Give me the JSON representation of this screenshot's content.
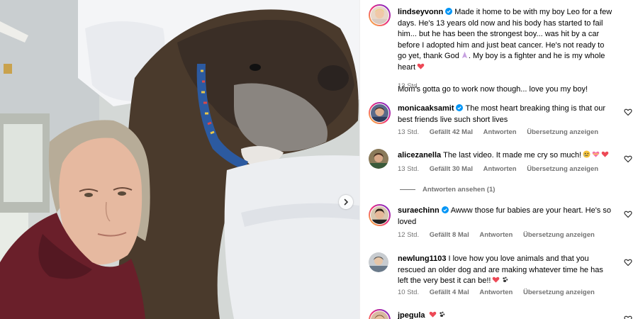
{
  "post": {
    "username": "lindseyvonn",
    "caption_p1": "Made it home to be with my boy Leo for a few days. He's 13 years old now and his body has started to fail him... but he has been the strongest boy... was hit by a car before I adopted him and just beat cancer. He's not ready to go yet, thank God",
    "caption_p2": ". My boy is a fighter and he is my whole heart",
    "caption_p3": "Mom's gotta go to work now though... love you my boy!",
    "time": "13 Std."
  },
  "comments": [
    {
      "username": "monicaaksamit",
      "verified": true,
      "text": "The most heart breaking thing is that our best friends live such short lives",
      "time": "13 Std.",
      "likes": "Gefällt 42 Mal",
      "reply": "Antworten",
      "translate": "Übersetzung anzeigen"
    },
    {
      "username": "alicezanella",
      "verified": false,
      "text": "The last video. It made me cry so much!",
      "time": "13 Std.",
      "likes": "Gefällt 30 Mal",
      "reply": "Antworten",
      "translate": "Übersetzung anzeigen"
    },
    {
      "username": "suraechinn",
      "verified": true,
      "text": "Awww those fur babies are your heart. He's so loved",
      "time": "12 Std.",
      "likes": "Gefällt 8 Mal",
      "reply": "Antworten",
      "translate": "Übersetzung anzeigen"
    },
    {
      "username": "newlung1103",
      "verified": false,
      "text": "I love how you love animals and that you rescued an older dog and are making whatever time he has left the very best it can be!!",
      "time": "10 Std.",
      "likes": "Gefällt 4 Mal",
      "reply": "Antworten",
      "translate": "Übersetzung anzeigen"
    },
    {
      "username": "jpegula",
      "verified": false,
      "text": ""
    }
  ],
  "view_replies": "Antworten ansehen (1)",
  "icons": {
    "verified": "verified-badge-icon",
    "like": "heart-outline-icon",
    "next": "chevron-right-icon"
  },
  "colors": {
    "verified": "#0095f6",
    "heart": "#ed4956",
    "meta_text": "#737373"
  }
}
